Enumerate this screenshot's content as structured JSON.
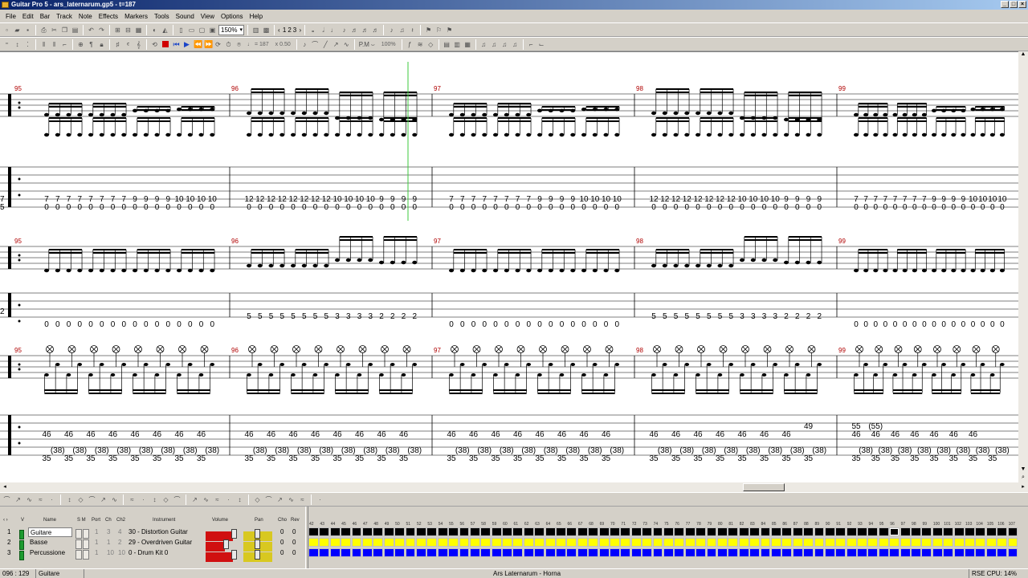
{
  "window": {
    "title": "Guitar Pro 5 - ars_laternarum.gp5 - t=187"
  },
  "menu": [
    "File",
    "Edit",
    "Bar",
    "Track",
    "Note",
    "Effects",
    "Markers",
    "Tools",
    "Sound",
    "View",
    "Options",
    "Help"
  ],
  "toolbar": {
    "zoom": "150%",
    "pages": [
      "1",
      "2",
      "3"
    ],
    "tempo": "♩ = 187",
    "speed": "x 0.50",
    "percent": "100%"
  },
  "score": {
    "bar_numbers": [
      "95",
      "96",
      "97",
      "98",
      "99"
    ],
    "guitar_tab": {
      "bars": [
        {
          "top": [
            "7",
            "7",
            "7",
            "7",
            "7",
            "7",
            "7",
            "7",
            "9",
            "9",
            "9",
            "9",
            "10",
            "10",
            "10",
            "10"
          ],
          "bottom": [
            "0",
            "0",
            "0",
            "0",
            "0",
            "0",
            "0",
            "0",
            "0",
            "0",
            "0",
            "0",
            "0",
            "0",
            "0",
            "0"
          ]
        },
        {
          "top": [
            "12",
            "12",
            "12",
            "12",
            "12",
            "12",
            "12",
            "12",
            "10",
            "10",
            "10",
            "10",
            "9",
            "9",
            "9",
            "9"
          ],
          "bottom": [
            "0",
            "0",
            "0",
            "0",
            "0",
            "0",
            "0",
            "0",
            "0",
            "0",
            "0",
            "0",
            "0",
            "0",
            "0",
            "0"
          ]
        },
        {
          "top": [
            "7",
            "7",
            "7",
            "7",
            "7",
            "7",
            "7",
            "7",
            "9",
            "9",
            "9",
            "9",
            "10",
            "10",
            "10",
            "10"
          ],
          "bottom": [
            "0",
            "0",
            "0",
            "0",
            "0",
            "0",
            "0",
            "0",
            "0",
            "0",
            "0",
            "0",
            "0",
            "0",
            "0",
            "0"
          ]
        },
        {
          "top": [
            "12",
            "12",
            "12",
            "12",
            "12",
            "12",
            "12",
            "12",
            "10",
            "10",
            "10",
            "10",
            "9",
            "9",
            "9",
            "9"
          ],
          "bottom": [
            "0",
            "0",
            "0",
            "0",
            "0",
            "0",
            "0",
            "0",
            "0",
            "0",
            "0",
            "0",
            "0",
            "0",
            "0",
            "0"
          ]
        },
        {
          "top": [
            "7",
            "7",
            "7",
            "7",
            "7",
            "7",
            "7",
            "7",
            "9",
            "9",
            "9",
            "9",
            "10",
            "10",
            "10",
            "10"
          ],
          "bottom": [
            "0",
            "0",
            "0",
            "0",
            "0",
            "0",
            "0",
            "0",
            "0",
            "0",
            "0",
            "0",
            "0",
            "0",
            "0",
            "0"
          ]
        }
      ],
      "clef_numbers": [
        "7",
        "5"
      ]
    },
    "bass_tab": {
      "bars": [
        {
          "top": [],
          "bottom": [
            "0",
            "0",
            "0",
            "0",
            "0",
            "0",
            "0",
            "0",
            "0",
            "0",
            "0",
            "0",
            "0",
            "0",
            "0",
            "0"
          ]
        },
        {
          "top": [
            "5",
            "5",
            "5",
            "5",
            "5",
            "5",
            "5",
            "5",
            "3",
            "3",
            "3",
            "3",
            "2",
            "2",
            "2",
            "2"
          ],
          "bottom": []
        },
        {
          "top": [],
          "bottom": [
            "0",
            "0",
            "0",
            "0",
            "0",
            "0",
            "0",
            "0",
            "0",
            "0",
            "0",
            "0",
            "0",
            "0",
            "0",
            "0"
          ]
        },
        {
          "top": [
            "5",
            "5",
            "5",
            "5",
            "5",
            "5",
            "5",
            "5",
            "3",
            "3",
            "3",
            "3",
            "2",
            "2",
            "2",
            "2"
          ],
          "bottom": []
        },
        {
          "top": [],
          "bottom": [
            "0",
            "0",
            "0",
            "0",
            "0",
            "0",
            "0",
            "0",
            "0",
            "0",
            "0",
            "0",
            "0",
            "0",
            "0",
            "0"
          ]
        }
      ],
      "clef_numbers": [
        "2"
      ]
    },
    "drum_tab": {
      "bars": [
        {
          "high": [
            "46",
            "46",
            "46",
            "46",
            "46",
            "46",
            "46",
            "46"
          ],
          "mid": [
            "(38)",
            "(38)",
            "(38)",
            "(38)",
            "(38)",
            "(38)",
            "(38)",
            "(38)"
          ],
          "low": [
            "35",
            "35",
            "35",
            "35",
            "35",
            "35",
            "35",
            "35"
          ]
        },
        {
          "high": [
            "46",
            "46",
            "46",
            "46",
            "46",
            "46",
            "46",
            "46"
          ],
          "mid": [
            "(38)",
            "(38)",
            "(38)",
            "(38)",
            "(38)",
            "(38)",
            "(38)",
            "(38)"
          ],
          "low": [
            "35",
            "35",
            "35",
            "35",
            "35",
            "35",
            "35",
            "35"
          ]
        },
        {
          "high": [
            "46",
            "46",
            "46",
            "46",
            "46",
            "46",
            "46",
            "46"
          ],
          "mid": [
            "(38)",
            "(38)",
            "(38)",
            "(38)",
            "(38)",
            "(38)",
            "(38)",
            "(38)"
          ],
          "low": [
            "35",
            "35",
            "35",
            "35",
            "35",
            "35",
            "35",
            "35"
          ]
        },
        {
          "high": [
            "46",
            "46",
            "46",
            "46",
            "46",
            "46",
            "46"
          ],
          "mid": [
            "(38)",
            "(38)",
            "(38)",
            "(38)",
            "(38)",
            "(38)",
            "(38)",
            "(38)"
          ],
          "low": [
            "35",
            "35",
            "35",
            "35",
            "35",
            "35",
            "35",
            "35"
          ],
          "extra": "49"
        },
        {
          "high": [
            "46",
            "46",
            "46",
            "46",
            "46",
            "46",
            "46"
          ],
          "mid": [
            "(38)",
            "(38)",
            "(38)",
            "(38)",
            "(38)",
            "(38)",
            "(38)",
            "(38)"
          ],
          "low": [
            "35",
            "35",
            "35",
            "35",
            "35",
            "35",
            "35",
            "35"
          ],
          "crash": [
            "55",
            "(55)"
          ]
        }
      ]
    }
  },
  "tracks": {
    "headers": {
      "v": "V",
      "name": "Name",
      "sm": "S M",
      "port": "Port",
      "ch": "Ch",
      "ch2": "Ch2",
      "instrument": "Instrument",
      "volume": "Volume",
      "pan": "Pan",
      "cho": "Cho",
      "rev": "Rev"
    },
    "rows": [
      {
        "num": "1",
        "name": "Guitare",
        "port": "1",
        "ch": "3",
        "ch2": "4",
        "instrument": "30 - Distortion Guitar",
        "volume": 0.85,
        "pan": 0.5,
        "cho": "0",
        "rev": "0",
        "color": "#000000"
      },
      {
        "num": "2",
        "name": "Basse",
        "port": "1",
        "ch": "1",
        "ch2": "2",
        "instrument": "29 - Overdriven Guitar",
        "volume": 0.6,
        "pan": 0.5,
        "cho": "0",
        "rev": "0",
        "color": "#ffff00"
      },
      {
        "num": "3",
        "name": "Percussione",
        "port": "1",
        "ch": "10",
        "ch2": "10",
        "instrument": "0 - Drum Kit 0",
        "volume": 0.85,
        "pan": 0.5,
        "cho": "0",
        "rev": "0",
        "color": "#0000ff"
      }
    ]
  },
  "bargrid": {
    "first_bar": 42,
    "last_bar": 107,
    "selected_bar": 96
  },
  "status": {
    "position": "096 : 129",
    "track": "Guitare",
    "song": "Ars Laternarum - Horna",
    "cpu": "RSE CPU: 14%"
  }
}
